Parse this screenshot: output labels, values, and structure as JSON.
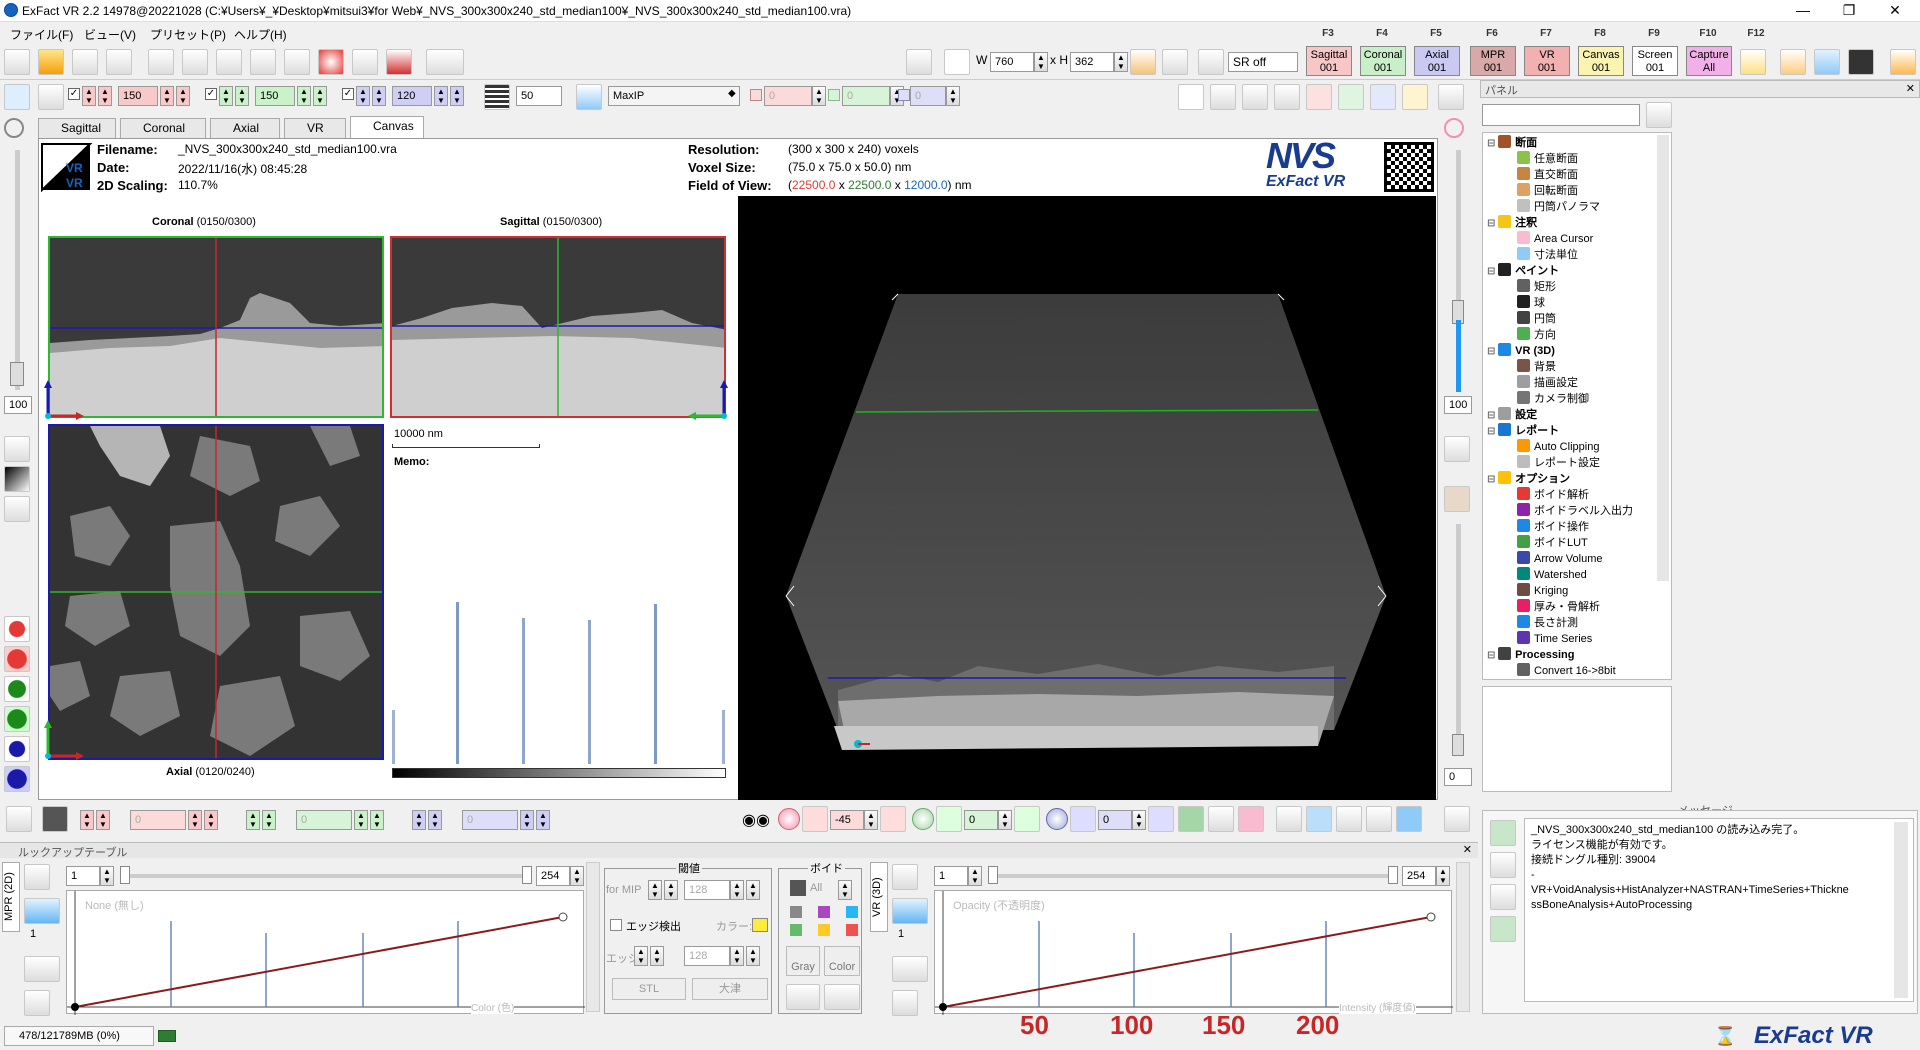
{
  "window": {
    "title": "ExFact VR 2.2 14978@20221028 (C:¥Users¥_¥Desktop¥mitsui3¥for Web¥_NVS_300x300x240_std_median100¥_NVS_300x300x240_std_median100.vra)",
    "min": "—",
    "max": "❐",
    "close": "✕"
  },
  "menu": [
    "ファイル(F)",
    "ビュー(V)",
    "プリセット(P)",
    "ヘルプ(H)"
  ],
  "fkeys": [
    "F3",
    "F4",
    "F5",
    "F6",
    "F7",
    "F8",
    "F9",
    "F10",
    "F12"
  ],
  "view_buttons": [
    {
      "label": "Sagittal",
      "sub": "001",
      "color": "#f7c6c6"
    },
    {
      "label": "Coronal",
      "sub": "001",
      "color": "#c8efc8"
    },
    {
      "label": "Axial",
      "sub": "001",
      "color": "#c9c9f2"
    },
    {
      "label": "MPR",
      "sub": "001",
      "color": "#d9a8a8"
    },
    {
      "label": "VR",
      "sub": "001",
      "color": "#f3b0b0"
    },
    {
      "label": "Canvas",
      "sub": "001",
      "color": "#fbf3b0"
    },
    {
      "label": "Screen",
      "sub": "001",
      "color": "#ffffff"
    },
    {
      "label": "Capture",
      "sub": "All",
      "color": "#f2b0e8"
    }
  ],
  "toolbar": {
    "w_label": "W",
    "w_value": "760",
    "h_label": "x H",
    "h_value": "362",
    "sr_select": "SR off"
  },
  "toolbar2": {
    "sag_val": "150",
    "cor_val": "150",
    "ax_val": "120",
    "thickness": "50",
    "mode": "MaxIP",
    "c1": "0",
    "c2": "0",
    "c3": "0"
  },
  "tabs": [
    "Sagittal",
    "Coronal",
    "Axial",
    "VR",
    "Canvas"
  ],
  "info": {
    "filename_label": "Filename:",
    "filename": "_NVS_300x300x240_std_median100.vra",
    "date_label": "Date:",
    "date": "2022/11/16(水) 08:45:28",
    "scaling_label": "2D Scaling:",
    "scaling": "110.7%",
    "res_label": "Resolution:",
    "res": "(300 x 300 x 240) voxels",
    "voxel_label": "Voxel Size:",
    "voxel": "(75.0 x 75.0 x 50.0) nm",
    "fov_label": "Field of View:",
    "fov_x": "22500.0",
    "fov_y": "22500.0",
    "fov_z": "12000.0",
    "fov_open": "(",
    "fov_x_sep": " x ",
    "fov_close": ") nm",
    "logo": "NVS",
    "logo_sub": "ExFact VR",
    "vr_badge": "VR"
  },
  "canvas": {
    "coronal_label": "Coronal",
    "coronal_idx": "(0150/0300)",
    "sagittal_label": "Sagittal",
    "sagittal_idx": "(0150/0300)",
    "axial_label": "Axial",
    "axial_idx": "(0120/0240)",
    "scalebar": "10000 nm",
    "memo": "Memo:"
  },
  "left_spin": "100",
  "right_spin": "100",
  "right_spin2": "0",
  "bottom_controls": {
    "v1": "0",
    "v2": "0",
    "v3": "0",
    "rot1": "-45",
    "rot2": "0",
    "rot3": "0"
  },
  "lut": {
    "title": "ルックアップテーブル",
    "mpr_tab": "MPR (2D)",
    "vr_tab": "VR (3D)",
    "mpr_min": "1",
    "mpr_max": "254",
    "mpr_plot_label": "None (無し)",
    "mpr_axis": "Color (色)",
    "mpr_count": "1",
    "thresh_title": "閾値",
    "void_title": "ボイド",
    "for_mip": "for MIP",
    "thr_val": "128",
    "edge_detect": "エッジ検出",
    "color_label": "カラー:",
    "edge_label": "エッジ",
    "edge_val": "128",
    "stl": "STL",
    "otsu": "大津",
    "void_all": "All",
    "gray": "Gray",
    "color": "Color",
    "vr_min": "1",
    "vr_max": "254",
    "vr_plot_label": "Opacity (不透明度)",
    "vr_axis": "Intensity (輝度値)",
    "vr_count": "1"
  },
  "scale_marks": [
    "50",
    "100",
    "150",
    "200"
  ],
  "panel": {
    "title": "パネル",
    "tree": [
      {
        "label": "断面",
        "cat": true,
        "color": "#a0522d"
      },
      {
        "label": "任意断面",
        "color": "#8bc34a"
      },
      {
        "label": "直交断面",
        "color": "#c68642"
      },
      {
        "label": "回転断面",
        "color": "#e0a060"
      },
      {
        "label": "円筒パノラマ",
        "color": "#c0c0c0"
      },
      {
        "label": "注釈",
        "cat": true,
        "color": "#f5c518"
      },
      {
        "label": "Area Cursor",
        "color": "#f8bbd0"
      },
      {
        "label": "寸法単位",
        "color": "#90caf9"
      },
      {
        "label": "ペイント",
        "cat": true,
        "color": "#212121"
      },
      {
        "label": "矩形",
        "color": "#616161"
      },
      {
        "label": "球",
        "color": "#212121"
      },
      {
        "label": "円筒",
        "color": "#424242"
      },
      {
        "label": "方向",
        "color": "#4caf50"
      },
      {
        "label": "VR (3D)",
        "cat": true,
        "color": "#1e88e5"
      },
      {
        "label": "背景",
        "color": "#795548"
      },
      {
        "label": "描画設定",
        "color": "#9e9e9e"
      },
      {
        "label": "カメラ制御",
        "color": "#757575"
      },
      {
        "label": "設定",
        "cat": true,
        "color": "#9e9e9e"
      },
      {
        "label": "レポート",
        "cat": true,
        "color": "#1976d2"
      },
      {
        "label": "Auto Clipping",
        "color": "#ff9800"
      },
      {
        "label": "レポート設定",
        "color": "#bdbdbd"
      },
      {
        "label": "オプション",
        "cat": true,
        "color": "#ffc107"
      },
      {
        "label": "ボイド解析",
        "color": "#e53935"
      },
      {
        "label": "ボイドラベル入出力",
        "color": "#8e24aa"
      },
      {
        "label": "ボイド操作",
        "color": "#1e88e5"
      },
      {
        "label": "ボイドLUT",
        "color": "#43a047"
      },
      {
        "label": "Arrow Volume",
        "color": "#3949ab"
      },
      {
        "label": "Watershed",
        "color": "#00897b"
      },
      {
        "label": "Kriging",
        "color": "#6d4c41"
      },
      {
        "label": "厚み・骨解析",
        "color": "#e91e63"
      },
      {
        "label": "長さ計測",
        "color": "#1e88e5"
      },
      {
        "label": "Time Series",
        "color": "#5e35b1"
      },
      {
        "label": "Processing",
        "cat": true,
        "color": "#424242"
      },
      {
        "label": "Convert 16->8bit",
        "color": "#616161"
      }
    ]
  },
  "messages": {
    "title": "メッセージ",
    "lines": [
      "_NVS_300x300x240_std_median100 の読み込み完了。",
      "ライセンス機能が有効です。",
      "接続ドングル種別: 39004",
      "-",
      "VR+VoidAnalysis+HistAnalyzer+NASTRAN+TimeSeries+Thickne",
      "ssBoneAnalysis+AutoProcessing"
    ]
  },
  "status": {
    "memory": "478/121789MB (0%)",
    "brand": "ExFact VR"
  }
}
